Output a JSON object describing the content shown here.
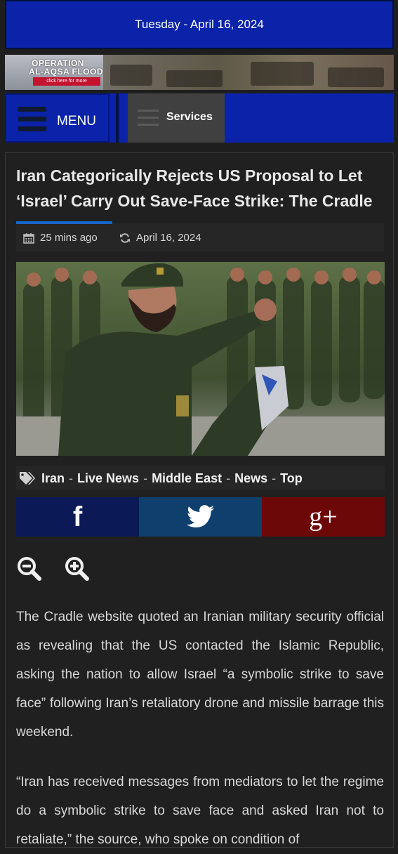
{
  "header": {
    "date": "Tuesday - April 16, 2024"
  },
  "banner": {
    "line1": "OPERATION",
    "line2": "AL-AQSA FLOOD",
    "cta": "click here for more"
  },
  "nav": {
    "menu_label": "MENU",
    "services_label": "Services"
  },
  "article": {
    "title": "Iran Categorically Rejects US Proposal to Let ‘Israel’ Carry Out Save-Face Strike: The Cradle",
    "meta": {
      "time_ago": "25 mins ago",
      "date": "April 16, 2024",
      "time_icon": "calendar-icon",
      "date_icon": "refresh-icon"
    },
    "tags": [
      "Iran",
      "Live News",
      "Middle East",
      "News",
      "Top"
    ],
    "tag_separator": "-",
    "share": {
      "facebook": "f",
      "twitter": "twitter-bird-icon",
      "google_plus": "g+",
      "colors": {
        "facebook": "#0b1a56",
        "twitter": "#0e3f6d",
        "google_plus": "#6d0808"
      }
    },
    "zoom": {
      "out_icon": "zoom-out-icon",
      "in_icon": "zoom-in-icon"
    },
    "paragraphs": [
      "The Cradle website quoted an Iranian military security official as revealing that the US contacted the Islamic Republic, asking the nation to allow Israel “a symbolic strike to save face” following Iran’s retaliatory drone and missile barrage this weekend.",
      "“Iran has received messages from mediators to let the regime do a symbolic strike to save face and asked Iran not to retaliate,” the source, who spoke on condition of"
    ]
  },
  "colors": {
    "accent_blue": "#0a23a8",
    "link_underline": "#1666c8",
    "background": "#1e1e1e"
  }
}
